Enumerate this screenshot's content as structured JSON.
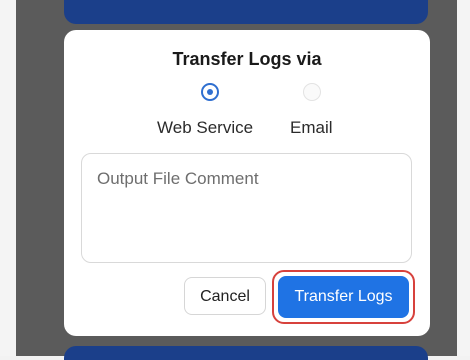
{
  "dialog": {
    "title": "Transfer Logs via",
    "options": [
      {
        "label": "Web Service",
        "selected": true
      },
      {
        "label": "Email",
        "selected": false
      }
    ],
    "comment_placeholder": "Output File Comment",
    "cancel_label": "Cancel",
    "transfer_label": "Transfer Logs"
  },
  "colors": {
    "accent": "#1f73e4",
    "header_bar": "#1b3f8a",
    "highlight": "#d7413c"
  }
}
